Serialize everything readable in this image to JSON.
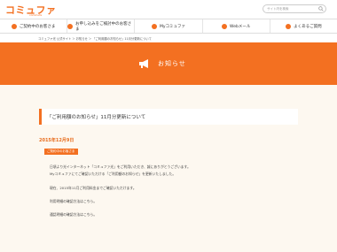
{
  "header": {
    "logo": "コミュファ",
    "logo_sub": "commufa",
    "search_placeholder": "サイト内を検索"
  },
  "nav": {
    "items": [
      {
        "label": "ご契約中のお客さま"
      },
      {
        "label": "お申し込みをご検討中のお客さま"
      },
      {
        "label": "Myコミュファ"
      },
      {
        "label": "Webメール"
      },
      {
        "label": "よくあるご質問"
      }
    ]
  },
  "breadcrumb": "コミュファ光 公式サイト ＞ お知らせ ＞ 「ご利用額のお知らせ」11月分更新について",
  "hero": {
    "title": "お知らせ"
  },
  "article": {
    "title": "「ご利用額のお知らせ」11月分更新について",
    "date": "2015年12月9日",
    "badge": "ご契約中のお客さま",
    "paragraphs": [
      "日頃より光インターネット「コミュファ光」をご利用いただき、誠にありがとうございます。",
      "Myコミュファにてご確認いただける「ご利用額のお知らせ」を更新いたしました。",
      "現在、2015年11月ご利用料金までご確認いただけます。",
      "利用明細の確認方法はこちら。",
      "通話明細の確認方法はこちら。"
    ]
  },
  "colors": {
    "accent": "#f37021",
    "content_bg": "#fdf8f0"
  }
}
